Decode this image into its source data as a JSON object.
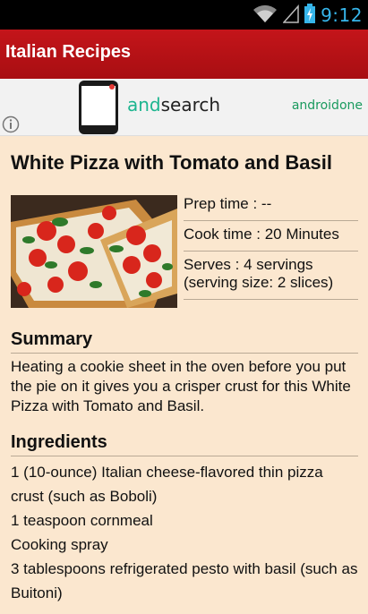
{
  "status_bar": {
    "time": "9:12",
    "icons": [
      "wifi-icon",
      "signal-icon",
      "battery-charging-icon"
    ],
    "time_color": "#36b5ea"
  },
  "app_bar": {
    "title": "Italian Recipes",
    "background": "#b8121a"
  },
  "ad": {
    "brand_part1": "and",
    "brand_part2": "search",
    "secondary": "androidone",
    "info_icon": "info-icon"
  },
  "recipe": {
    "title": "White Pizza with Tomato and Basil",
    "image": "pizza-photo",
    "prep_time": "Prep time : --",
    "cook_time": "Cook time : 20 Minutes",
    "serves": "Serves : 4 servings (serving size: 2 slices)",
    "summary_heading": "Summary",
    "summary": "Heating a cookie sheet in the oven before you put the pie on it gives you a crisper crust for this White Pizza with Tomato and Basil.",
    "ingredients_heading": "Ingredients",
    "ingredients": [
      "1 (10-ounce) Italian cheese-flavored thin pizza crust (such as Boboli)",
      "1 teaspoon cornmeal",
      "Cooking spray",
      "3 tablespoons refrigerated pesto with basil (such as Buitoni)"
    ]
  }
}
